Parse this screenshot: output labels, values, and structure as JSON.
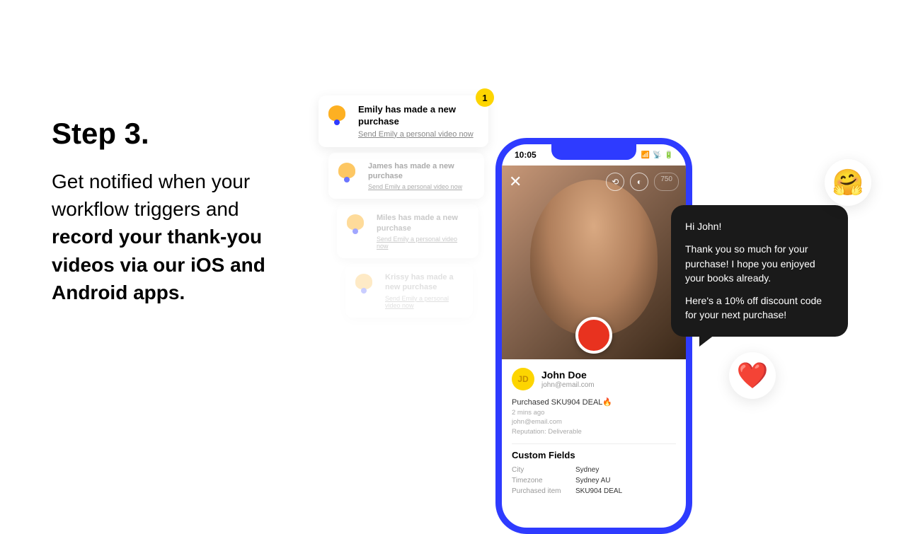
{
  "step": {
    "title": "Step 3.",
    "body_plain": "Get notified when your workflow triggers and ",
    "body_bold": "record your thank-you videos via our iOS and Android apps."
  },
  "notifications": [
    {
      "title": "Emily has made a new purchase",
      "link": "Send Emily a personal video now",
      "badge": "1"
    },
    {
      "title": "James has made a new purchase",
      "link": "Send Emily a personal video now"
    },
    {
      "title": "Miles has made a new purchase",
      "link": "Send Emily a personal video now"
    },
    {
      "title": "Krissy has made a new purchase",
      "link": "Send Emily a personal video now"
    }
  ],
  "phone": {
    "time": "10:05",
    "speed": "750",
    "user": {
      "initials": "JD",
      "name": "John Doe",
      "email": "john@email.com",
      "purchase": "Purchased SKU904 DEAL🔥",
      "meta1": "2 mins ago",
      "meta2": "john@email.com",
      "meta3": "Reputation: Deliverable"
    },
    "custom_fields_heading": "Custom Fields",
    "custom_fields": [
      {
        "label": "City",
        "value": "Sydney"
      },
      {
        "label": "Timezone",
        "value": "Sydney AU"
      },
      {
        "label": "Purchased item",
        "value": "SKU904 DEAL"
      }
    ]
  },
  "bubble": {
    "greeting": "Hi John!",
    "p1": "Thank you so much for your purchase! I hope you enjoyed your books already.",
    "p2": "Here's a 10% off discount code for your next purchase!"
  },
  "emojis": {
    "hug": "🤗",
    "heart": "❤️"
  }
}
